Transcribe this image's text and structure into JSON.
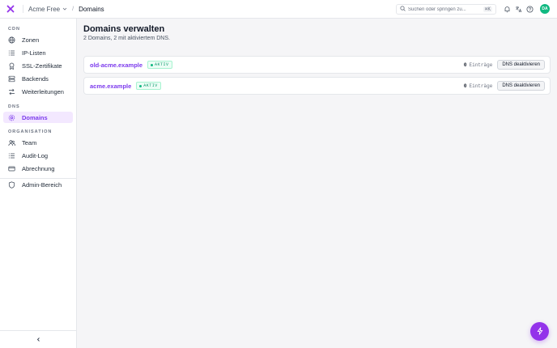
{
  "header": {
    "org_name": "Acme Free",
    "breadcrumb_separator": "/",
    "current_page": "Domains",
    "search_placeholder": "Suchen oder springen zu...",
    "search_shortcut": "⌘K",
    "avatar_initials": "DA"
  },
  "sidebar": {
    "sections": [
      {
        "label": "CDN",
        "items": [
          {
            "label": "Zonen",
            "icon": "globe-icon"
          },
          {
            "label": "IP-Listen",
            "icon": "list-icon"
          },
          {
            "label": "SSL-Zertifikate",
            "icon": "certificate-icon"
          },
          {
            "label": "Backends",
            "icon": "server-icon"
          },
          {
            "label": "Weiterleitungen",
            "icon": "redirect-icon"
          }
        ]
      },
      {
        "label": "DNS",
        "items": [
          {
            "label": "Domains",
            "icon": "gear-icon",
            "active": true
          }
        ]
      },
      {
        "label": "ORGANISATION",
        "items": [
          {
            "label": "Team",
            "icon": "team-icon"
          },
          {
            "label": "Audit-Log",
            "icon": "list-icon"
          },
          {
            "label": "Abrechnung",
            "icon": "credit-card-icon"
          }
        ]
      },
      {
        "label": "",
        "items": [
          {
            "label": "Admin-Bereich",
            "icon": "shield-icon"
          }
        ]
      }
    ]
  },
  "main": {
    "title": "Domains verwalten",
    "subtitle": "2 Domains, 2 mit aktiviertem DNS.",
    "domains": [
      {
        "name": "old-acme.example",
        "status": "AKTIV",
        "records_count": "0",
        "records_label": "Einträge",
        "action": "DNS deaktivieren"
      },
      {
        "name": "acme.example",
        "status": "AKTIV",
        "records_count": "0",
        "records_label": "Einträge",
        "action": "DNS deaktivieren"
      }
    ]
  },
  "colors": {
    "accent": "#7c3aed",
    "fab": "#9333ea",
    "success": "#10b981",
    "avatar": "#10b981"
  }
}
